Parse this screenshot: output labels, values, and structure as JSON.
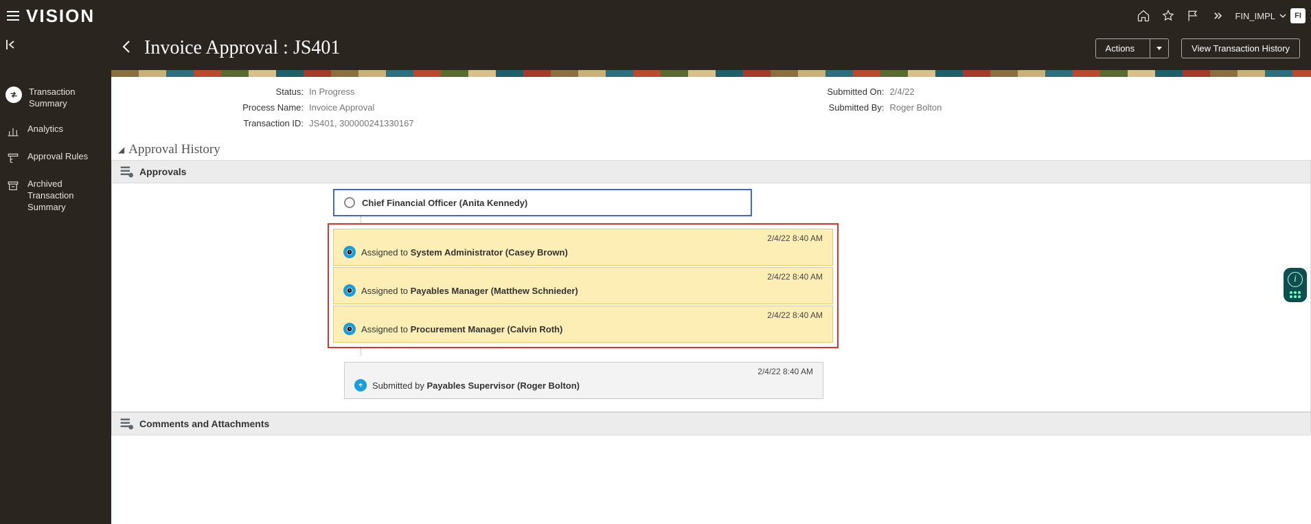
{
  "topbar": {
    "logo": "VISION",
    "user_label": "FIN_IMPL",
    "user_initials": "FI"
  },
  "sidebar": {
    "items": [
      {
        "label": "Transaction Summary"
      },
      {
        "label": "Analytics"
      },
      {
        "label": "Approval Rules"
      },
      {
        "label": "Archived Transaction Summary"
      }
    ]
  },
  "subheader": {
    "title": "Invoice Approval : JS401",
    "actions_label": "Actions",
    "view_history_label": "View Transaction History"
  },
  "info": {
    "status_label": "Status:",
    "status_value": "In Progress",
    "process_label": "Process Name:",
    "process_value": "Invoice Approval",
    "txn_label": "Transaction ID:",
    "txn_value": "JS401, 300000241330167",
    "subon_label": "Submitted On:",
    "subon_value": "2/4/22",
    "subby_label": "Submitted By:",
    "subby_value": "Roger Bolton"
  },
  "section": {
    "approval_history": "Approval History",
    "approvals": "Approvals",
    "comments": "Comments and Attachments"
  },
  "history": {
    "cfo_role": "Chief Financial Officer (Anita Kennedy)",
    "assigned_prefix": "Assigned to",
    "submitted_prefix": "Submitted by",
    "pending": [
      {
        "ts": "2/4/22 8:40 AM",
        "who": "System Administrator (Casey Brown)"
      },
      {
        "ts": "2/4/22 8:40 AM",
        "who": "Payables Manager (Matthew Schnieder)"
      },
      {
        "ts": "2/4/22 8:40 AM",
        "who": "Procurement Manager (Calvin Roth)"
      }
    ],
    "submitted": {
      "ts": "2/4/22 8:40 AM",
      "who": "Payables Supervisor (Roger Bolton)"
    }
  }
}
